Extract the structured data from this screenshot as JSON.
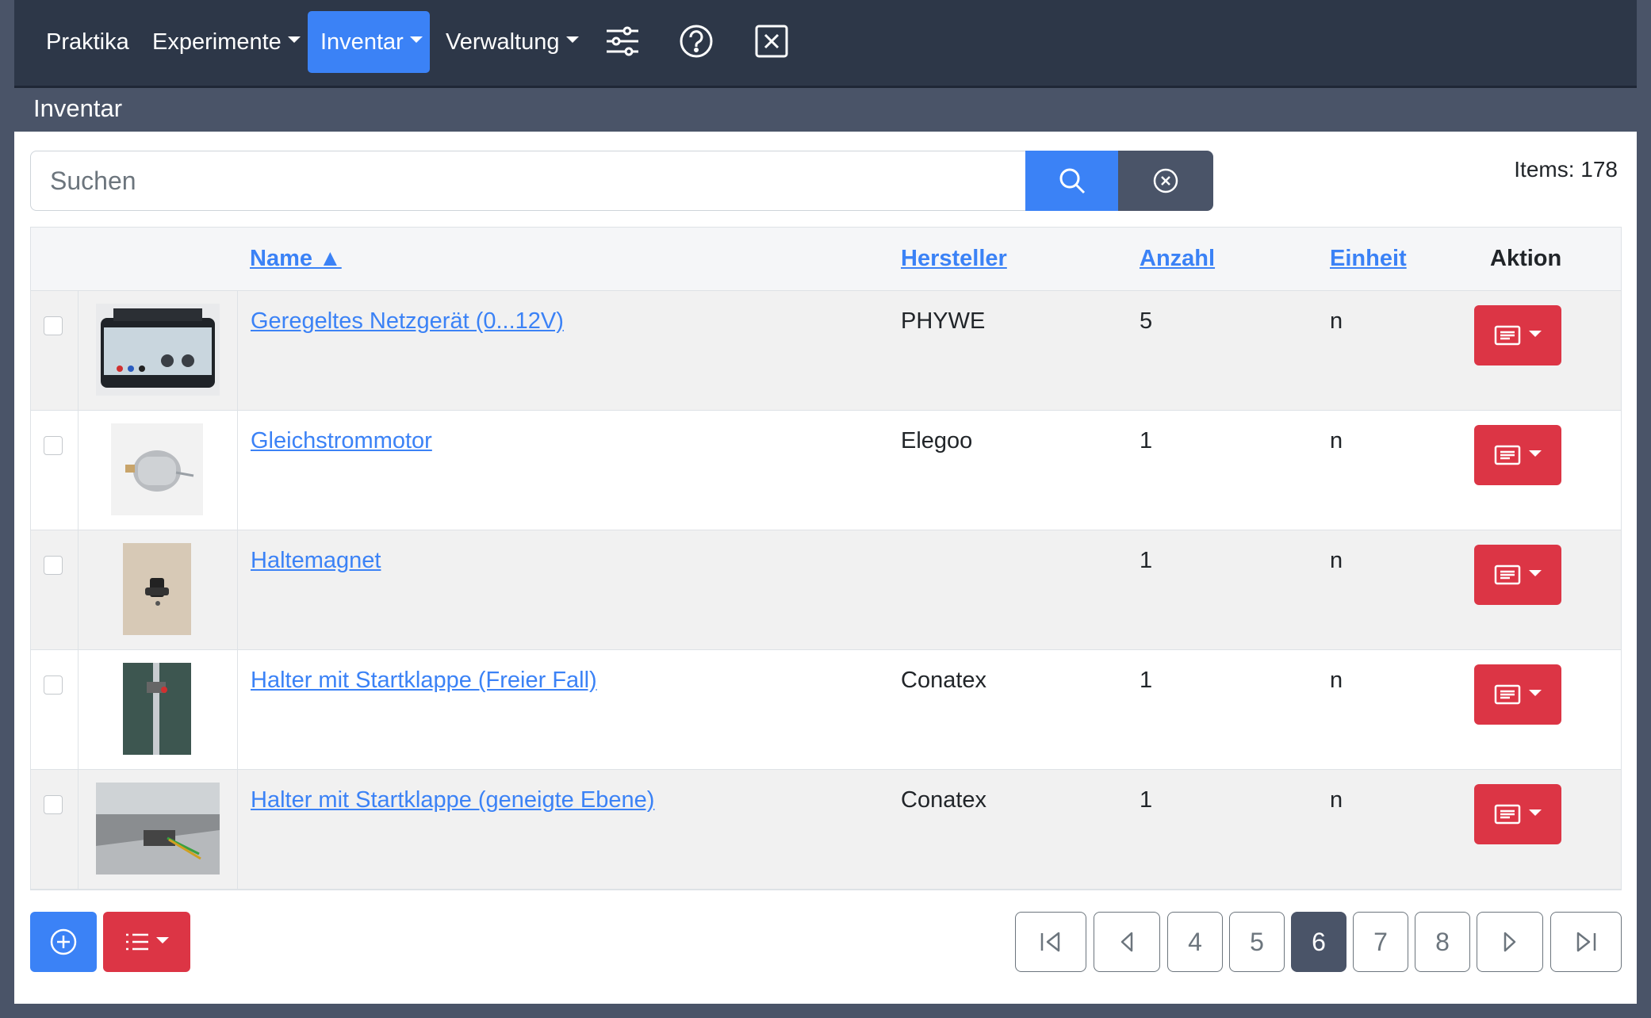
{
  "nav": {
    "items": [
      {
        "label": "Praktika",
        "dropdown": false,
        "active": false
      },
      {
        "label": "Experimente",
        "dropdown": true,
        "active": false
      },
      {
        "label": "Inventar",
        "dropdown": true,
        "active": true
      },
      {
        "label": "Verwaltung",
        "dropdown": true,
        "active": false
      }
    ],
    "icons": [
      "sliders-icon",
      "help-circle-icon",
      "close-square-icon"
    ]
  },
  "page": {
    "title": "Inventar"
  },
  "search": {
    "placeholder": "Suchen",
    "value": ""
  },
  "items_count": "Items: 178",
  "table": {
    "headers": {
      "name": "Name ▲",
      "manufacturer": "Hersteller",
      "count": "Anzahl",
      "unit": "Einheit",
      "action": "Aktion"
    },
    "rows": [
      {
        "name": "Geregeltes Netzgerät (0...12V)",
        "manufacturer": "PHYWE",
        "count": "5",
        "unit": "n",
        "checked": false
      },
      {
        "name": "Gleichstrommotor",
        "manufacturer": "Elegoo",
        "count": "1",
        "unit": "n",
        "checked": false
      },
      {
        "name": "Haltemagnet",
        "manufacturer": "",
        "count": "1",
        "unit": "n",
        "checked": false
      },
      {
        "name": "Halter mit Startklappe (Freier Fall)",
        "manufacturer": "Conatex",
        "count": "1",
        "unit": "n",
        "checked": false
      },
      {
        "name": "Halter mit Startklappe (geneigte Ebene)",
        "manufacturer": "Conatex",
        "count": "1",
        "unit": "n",
        "checked": false
      }
    ]
  },
  "pagination": {
    "pages": [
      "4",
      "5",
      "6",
      "7",
      "8"
    ],
    "current": "6"
  },
  "colors": {
    "navbar": "#2d3748",
    "accent": "#3b82f6",
    "danger": "#dc3545",
    "secondary": "#4a5468"
  }
}
